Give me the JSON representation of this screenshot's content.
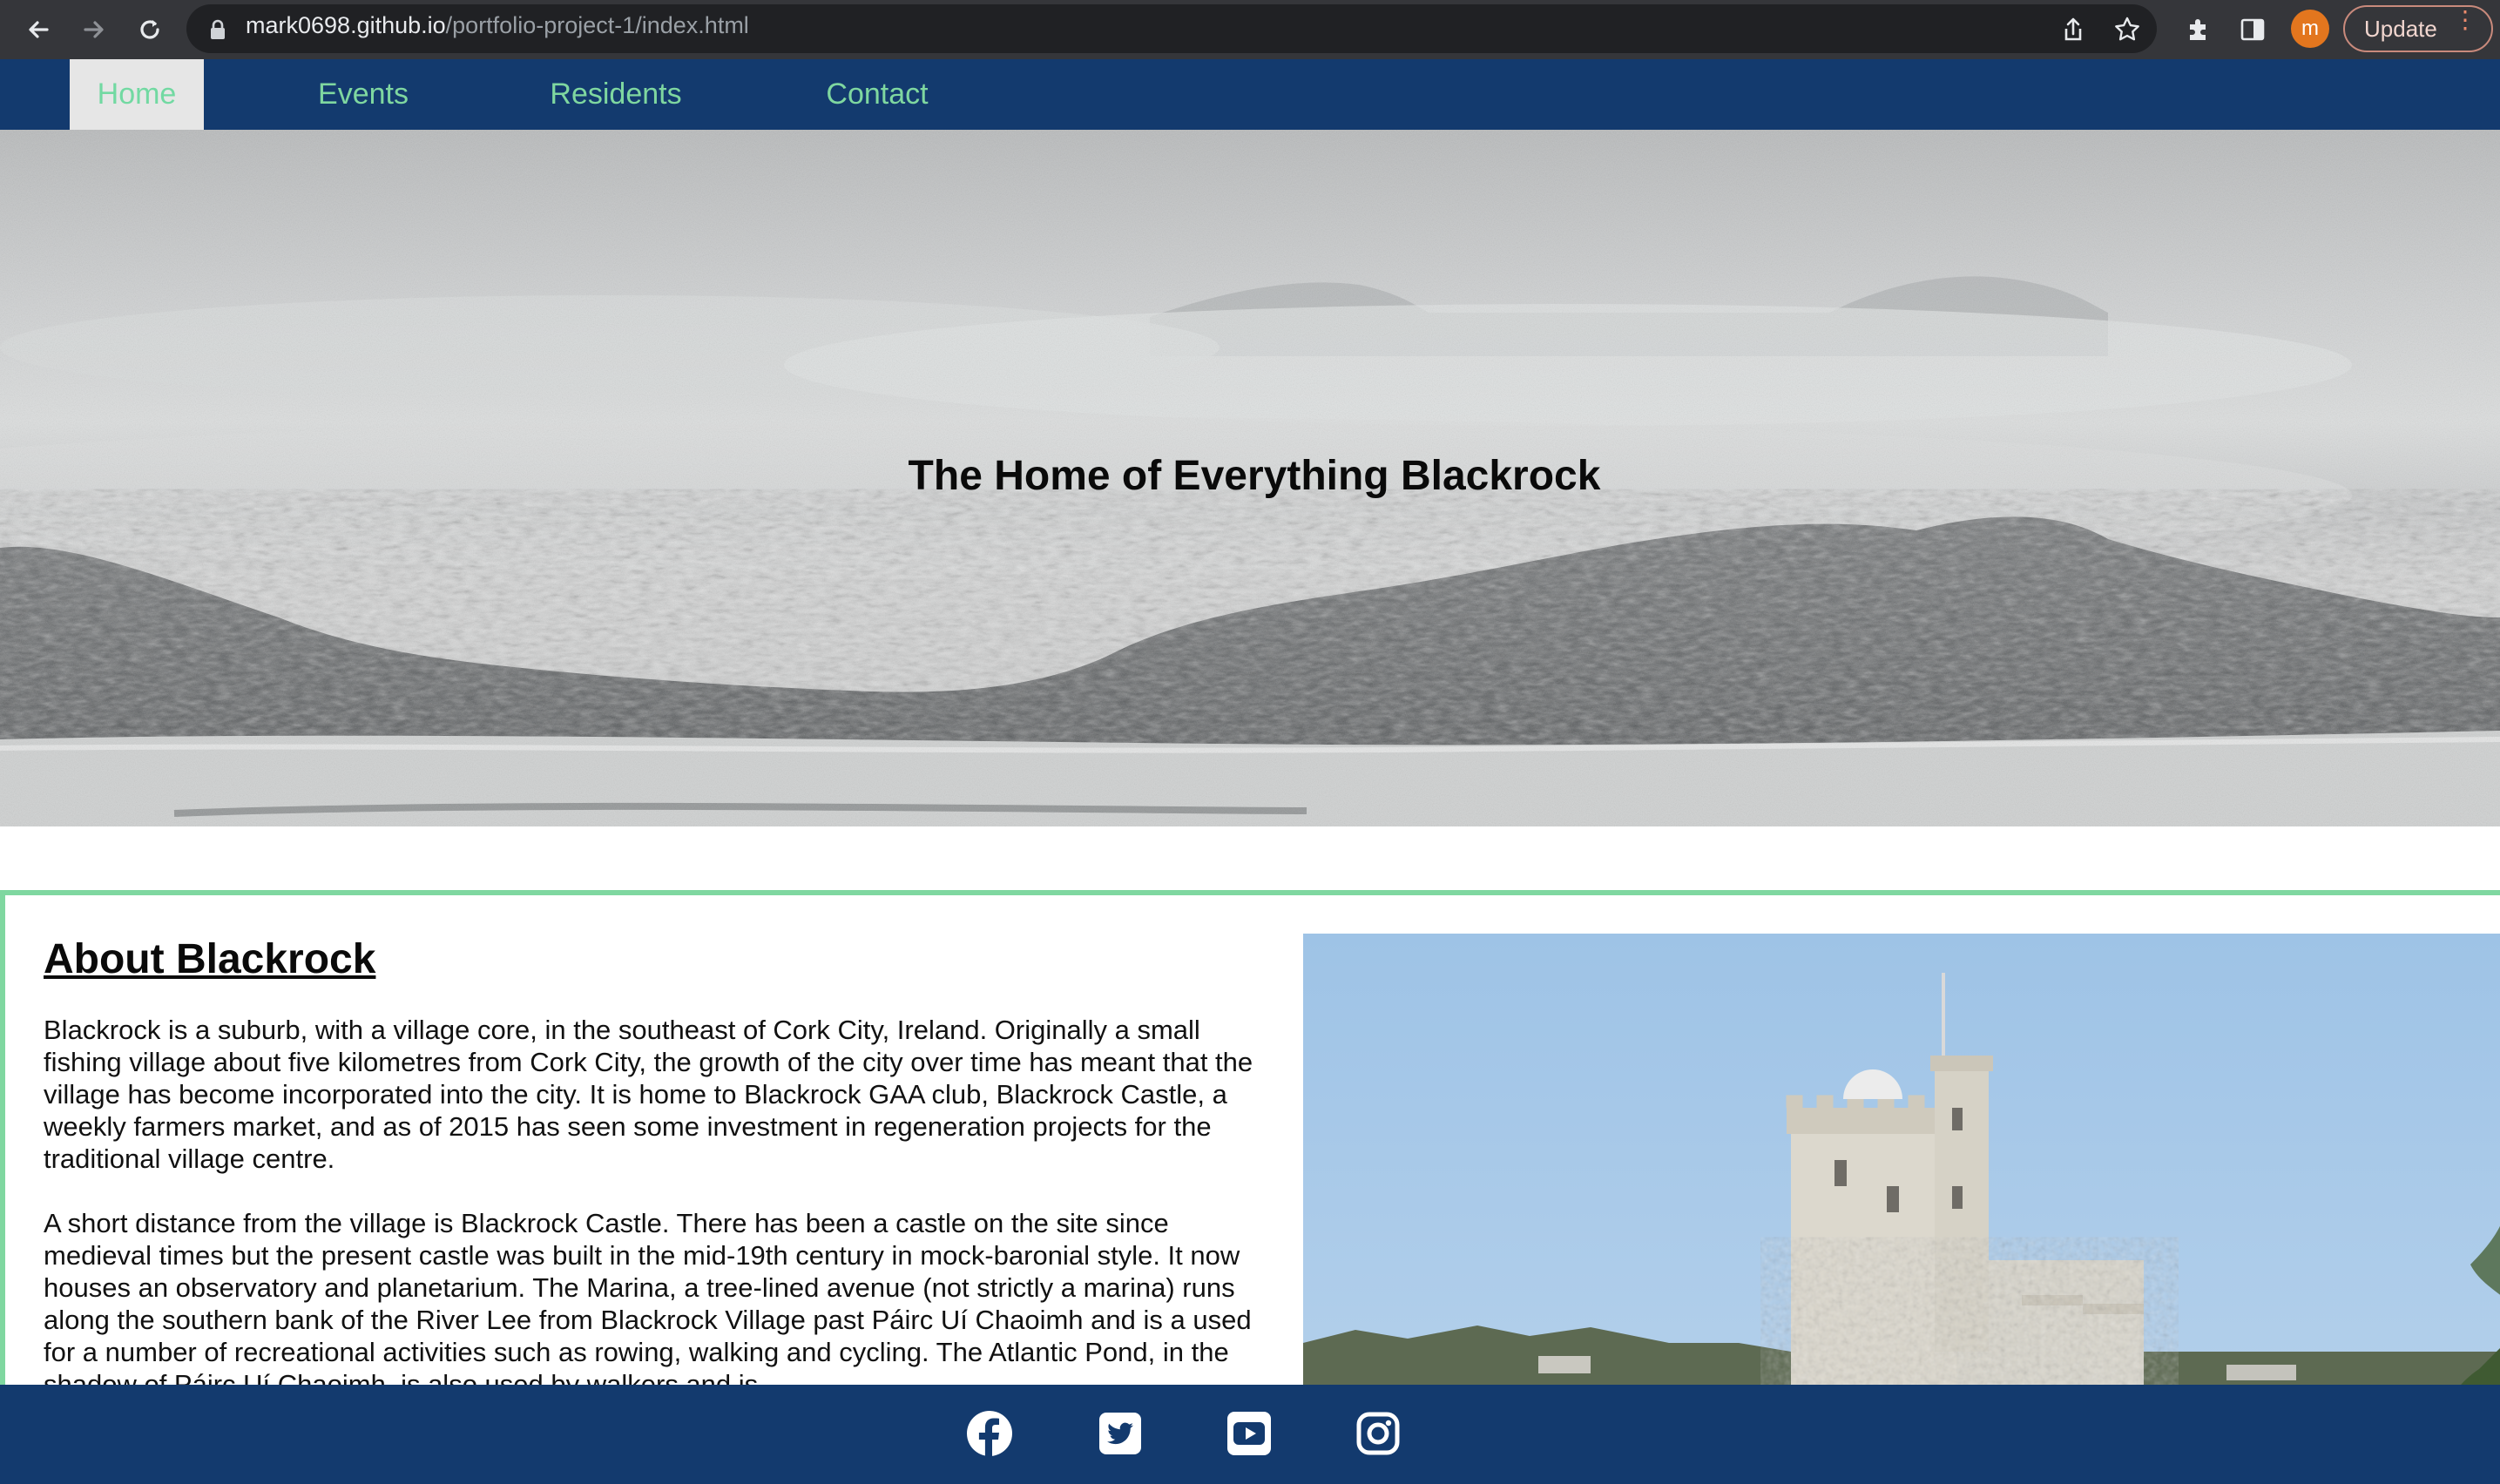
{
  "browser": {
    "url_host": "mark0698.github.io",
    "url_path": "/portfolio-project-1/index.html",
    "profile_initial": "m",
    "update_label": "Update",
    "icons": [
      "back-icon",
      "forward-icon",
      "reload-icon",
      "lock-icon",
      "share-icon",
      "star-icon",
      "extensions-icon",
      "side-panel-icon",
      "more-icon"
    ]
  },
  "nav": {
    "items": [
      {
        "label": "Home",
        "active": true
      },
      {
        "label": "Events",
        "active": false
      },
      {
        "label": "Residents",
        "active": false
      },
      {
        "label": "Contact",
        "active": false
      }
    ]
  },
  "hero": {
    "title": "The Home of Everything Blackrock"
  },
  "about": {
    "title": "About Blackrock",
    "paragraphs": [
      "Blackrock is a suburb, with a village core, in the southeast of Cork City, Ireland. Originally a small fishing village about five kilometres from Cork City, the growth of the city over time has meant that the village has become incorporated into the city. It is home to Blackrock GAA club, Blackrock Castle, a weekly farmers market, and as of 2015 has seen some investment in regeneration projects for the traditional village centre.",
      "A short distance from the village is Blackrock Castle. There has been a castle on the site since medieval times but the present castle was built in the mid-19th century in mock-baronial style. It now houses an observatory and planetarium. The Marina, a tree-lined avenue (not strictly a marina) runs along the southern bank of the River Lee from Blackrock Village past Páirc Uí Chaoimh and is a used for a number of recreational activities such as rowing, walking and cycling. The Atlantic Pond, in the shadow of Páirc Uí Chaoimh, is also used by walkers and is"
    ]
  },
  "footer": {
    "social_icons": [
      "facebook-icon",
      "twitter-icon",
      "youtube-icon",
      "instagram-icon"
    ]
  },
  "colors": {
    "brand_navy": "#133a6e",
    "accent_green": "#7fd7a0"
  }
}
